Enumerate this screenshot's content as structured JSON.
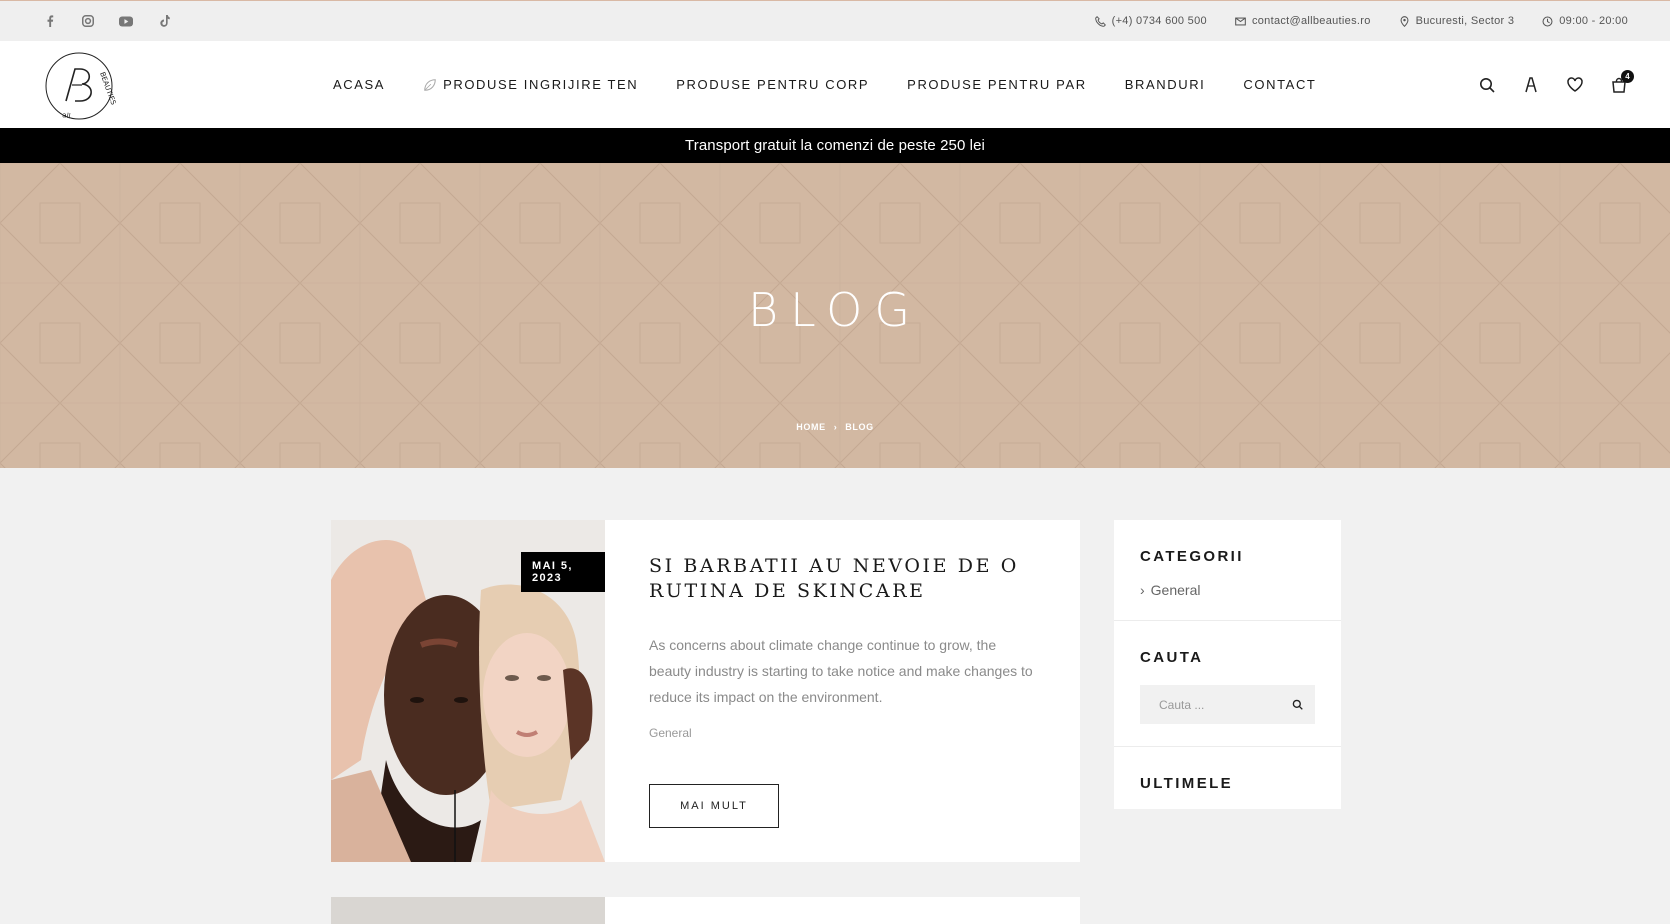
{
  "topbar": {
    "social": [
      "facebook-icon",
      "instagram-icon",
      "youtube-icon",
      "tiktok-icon"
    ],
    "phone": "(+4) 0734 600 500",
    "email": "contact@allbeauties.ro",
    "address": "Bucuresti, Sector 3",
    "hours": "09:00 - 20:00"
  },
  "header": {
    "logo_text": "allBEAUTIES",
    "nav": [
      "ACASA",
      "PRODUSE INGRIJIRE TEN",
      "PRODUSE PENTRU CORP",
      "PRODUSE PENTRU PAR",
      "BRANDURI",
      "CONTACT"
    ],
    "cart_count": "4"
  },
  "promo": {
    "text": "Transport gratuit la comenzi de peste 250 lei"
  },
  "hero": {
    "title": "BLOG",
    "breadcrumb": [
      "HOME",
      "BLOG"
    ]
  },
  "post": {
    "date": "MAI 5, 2023",
    "title": "SI BARBATII AU NEVOIE DE O RUTINA DE SKINCARE",
    "excerpt": "As concerns about climate change continue to grow, the beauty industry is starting to take notice and make changes to reduce its impact on the environment.",
    "category": "General",
    "button": "MAI MULT"
  },
  "sidebar": {
    "categories_title": "CATEGORII",
    "categories": [
      "General"
    ],
    "search_title": "CAUTA",
    "search_placeholder": "Cauta ...",
    "latest_title": "ULTIMELE"
  },
  "colors": {
    "hero_bg": "#d2b8a2",
    "promo_bg": "#000000",
    "page_bg": "#f1f1f1"
  }
}
